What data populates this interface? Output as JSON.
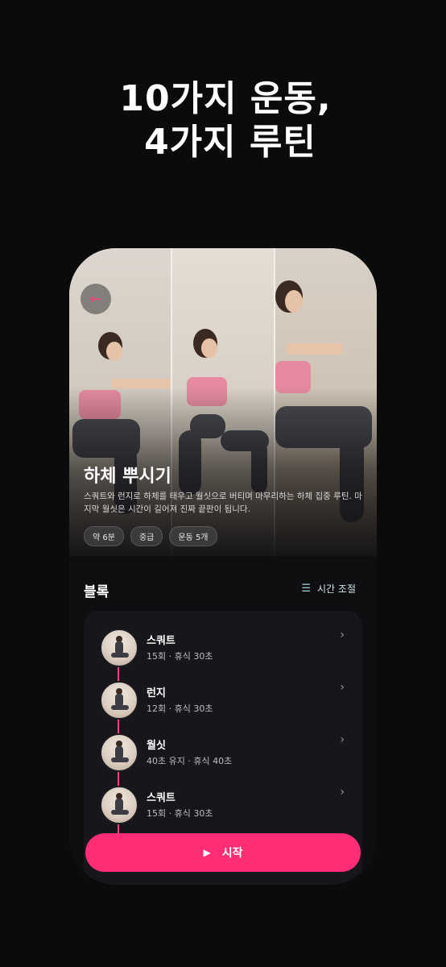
{
  "headline": {
    "line1": "10가지 운동,",
    "line2": "4가지 루틴"
  },
  "hero": {
    "back_icon": "arrow-left-icon",
    "title": "하체 뿌시기",
    "description": "스쿼트와 런지로 하체를 태우고 월싯으로 버티며 마무리하는 하체 집중 루틴. 마지막 월싯은 시간이 길어져 진짜 끝판이 됩니다.",
    "chips": [
      "약 6분",
      "중급",
      "운동 5개"
    ]
  },
  "blocks": {
    "title": "블록",
    "time_adjust_label": "시간 조절",
    "time_adjust_icon": "sliders-icon",
    "items": [
      {
        "name": "스쿼트",
        "meta": "15회 · 휴식 30초"
      },
      {
        "name": "런지",
        "meta": "12회 · 휴식 30초"
      },
      {
        "name": "월싯",
        "meta": "40초 유지 · 휴식 40초"
      },
      {
        "name": "스쿼트",
        "meta": "15회 · 휴식 30초"
      }
    ]
  },
  "start_button": {
    "label": "시작",
    "icon": "play-icon"
  },
  "colors": {
    "accent": "#ff2d75",
    "background": "#0b0b0b",
    "card": "#17171b"
  }
}
